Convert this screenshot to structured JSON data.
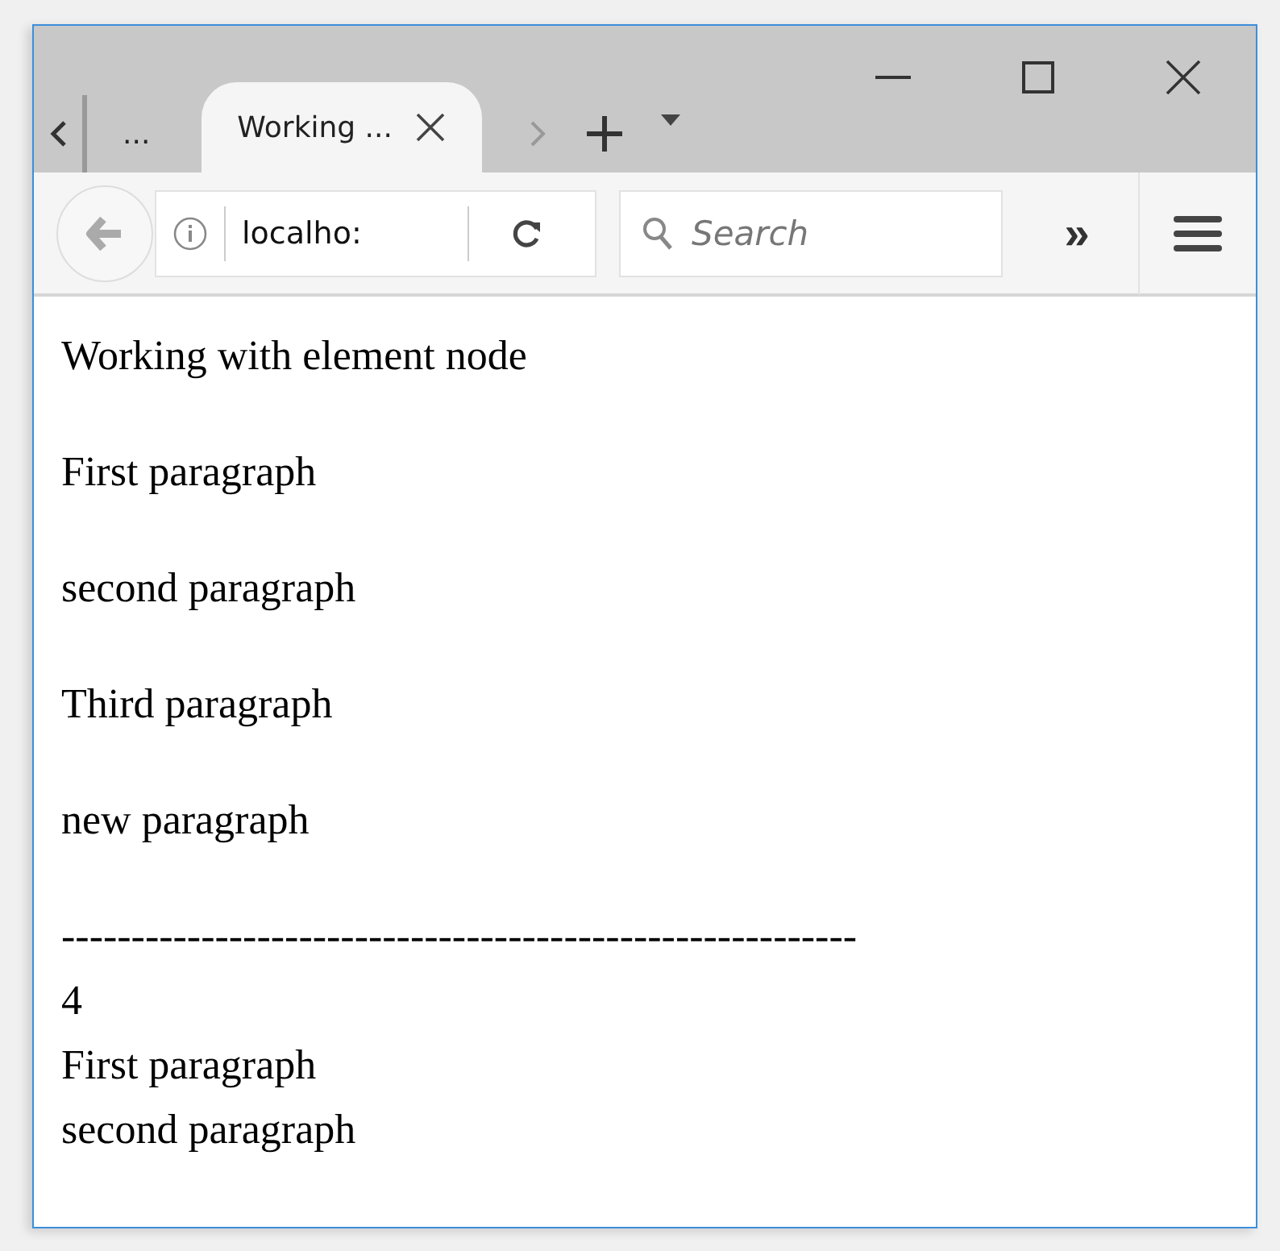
{
  "tabs": [
    {
      "label": "...",
      "selected": false
    },
    {
      "label": "Working ...",
      "selected": true
    }
  ],
  "tab_strip": {
    "scroll_back_disabled": false,
    "scroll_forward_disabled": true
  },
  "address_bar": {
    "value": "localho:"
  },
  "search": {
    "placeholder": "Search"
  },
  "overflow_button": {
    "label": "»"
  },
  "page": {
    "paragraphs": [
      "Working with element node",
      "First paragraph",
      "second paragraph",
      "Third paragraph",
      "new paragraph"
    ],
    "output_lines": [
      "---------------------------------------------------------",
      "4",
      "First paragraph",
      "second paragraph"
    ]
  }
}
